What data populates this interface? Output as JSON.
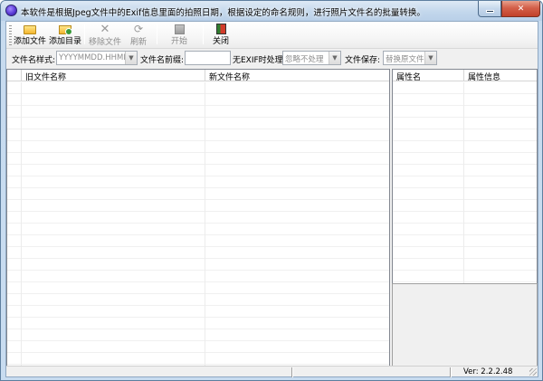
{
  "window": {
    "title": "本软件是根据Jpeg文件中的Exif信息里面的拍照日期，根据设定的命名规则，进行照片文件名的批量转换。",
    "minimize_glyph": "",
    "close_glyph": "✕"
  },
  "toolbar": {
    "add_file_label": "添加文件",
    "add_dir_label": "添加目录",
    "remove_file_label": "移除文件",
    "refresh_label": "刷新",
    "start_label": "开始",
    "close_label": "关闭",
    "remove_icon_glyph": "✕",
    "refresh_icon_glyph": "⟳"
  },
  "options": {
    "name_style_label": "文件名样式:",
    "name_style_value": "YYYYMMDD.HHMMSS",
    "prefix_label": "文件名前缀:",
    "prefix_value": "",
    "no_exif_label": "无EXIF时处理:",
    "no_exif_value": "忽略不处理",
    "save_label": "文件保存:",
    "save_value": "替换原文件",
    "dropdown_arrow": "▼"
  },
  "file_list": {
    "columns": [
      "",
      "旧文件名称",
      "新文件名称"
    ],
    "rows": []
  },
  "property_list": {
    "columns": [
      "属性名",
      "属性信息"
    ],
    "rows": []
  },
  "statusbar": {
    "version": "Ver: 2.2.2.48"
  },
  "colors": {
    "title_gradient_top": "#dde9f5",
    "close_button": "#c2412a",
    "disabled_text": "#8d8d8d"
  }
}
